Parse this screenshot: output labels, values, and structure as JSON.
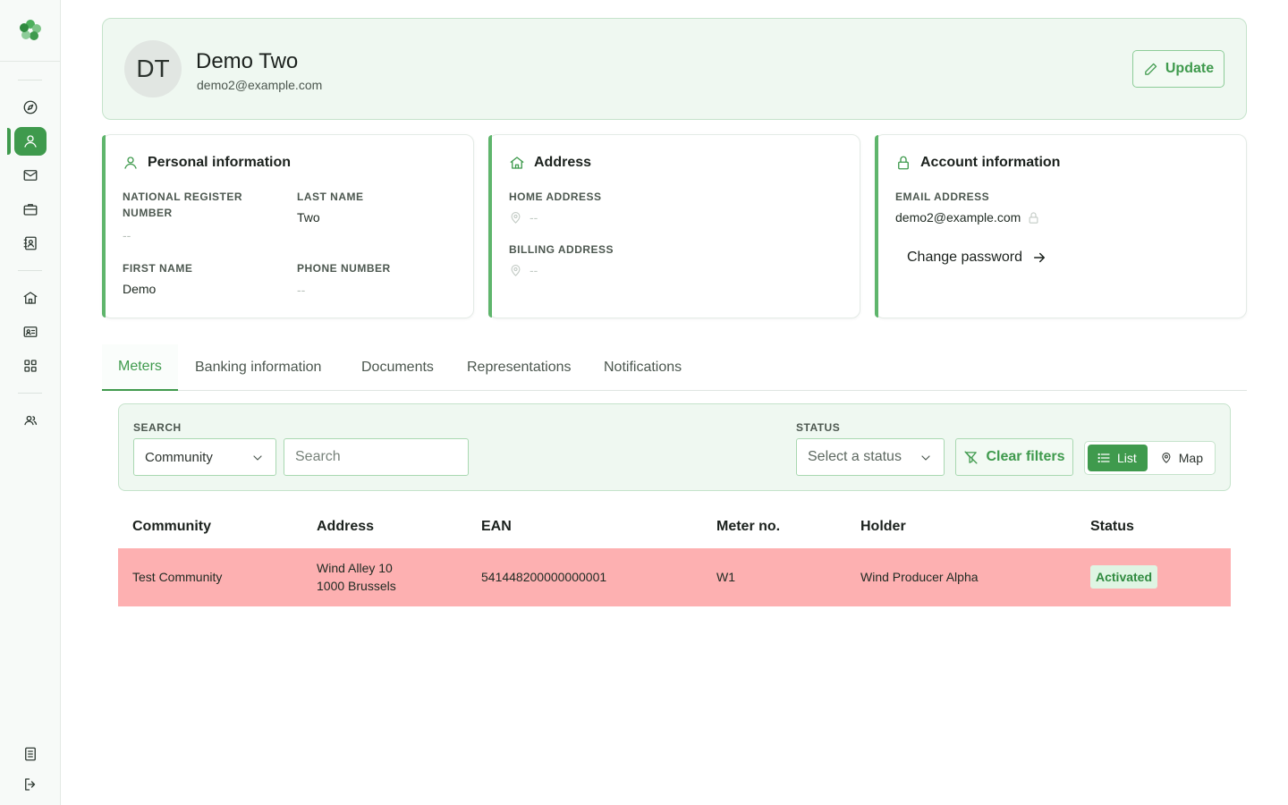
{
  "sidebar": {
    "logo": "clover-logo-icon",
    "items": [
      {
        "name": "compass-icon"
      },
      {
        "name": "user-icon",
        "active": true
      },
      {
        "name": "mail-icon"
      },
      {
        "name": "briefcase-icon"
      },
      {
        "name": "contacts-book-icon"
      },
      {
        "name": "building-icon"
      },
      {
        "name": "id-card-icon"
      },
      {
        "name": "grid-icon"
      },
      {
        "name": "users-icon"
      }
    ],
    "bottom": [
      {
        "name": "document-icon"
      },
      {
        "name": "logout-icon"
      }
    ]
  },
  "profile": {
    "initials": "DT",
    "name": "Demo Two",
    "email": "demo2@example.com",
    "update_label": "Update"
  },
  "personal": {
    "title": "Personal information",
    "national_register_label": "NATIONAL REGISTER NUMBER",
    "national_register_value": "--",
    "last_name_label": "LAST NAME",
    "last_name_value": "Two",
    "first_name_label": "FIRST NAME",
    "first_name_value": "Demo",
    "phone_label": "PHONE NUMBER",
    "phone_value": "--"
  },
  "address": {
    "title": "Address",
    "home_label": "HOME ADDRESS",
    "home_value": "--",
    "billing_label": "BILLING ADDRESS",
    "billing_value": "--"
  },
  "account": {
    "title": "Account information",
    "email_label": "EMAIL ADDRESS",
    "email_value": "demo2@example.com",
    "change_password_label": "Change password"
  },
  "tabs": [
    {
      "label": "Meters",
      "active": true
    },
    {
      "label": "Banking information"
    },
    {
      "label": "Documents"
    },
    {
      "label": "Representations"
    },
    {
      "label": "Notifications"
    }
  ],
  "filters": {
    "search_label": "SEARCH",
    "search_field_value": "Community",
    "search_placeholder": "Search",
    "status_label": "STATUS",
    "status_placeholder": "Select a status",
    "clear_label": "Clear filters",
    "list_label": "List",
    "map_label": "Map"
  },
  "table": {
    "headers": [
      "Community",
      "Address",
      "EAN",
      "Meter no.",
      "Holder",
      "Status"
    ],
    "rows": [
      {
        "community": "Test Community",
        "address_line1": "Wind Alley 10",
        "address_line2": "1000 Brussels",
        "ean": "541448200000000001",
        "meter_no": "W1",
        "holder": "Wind Producer Alpha",
        "status": "Activated"
      }
    ]
  },
  "colors": {
    "accent": "#3f9a4d",
    "panel_bg": "#eff8f1",
    "row_highlight": "#fdb0b1",
    "status_badge_bg": "#dff5e3"
  }
}
